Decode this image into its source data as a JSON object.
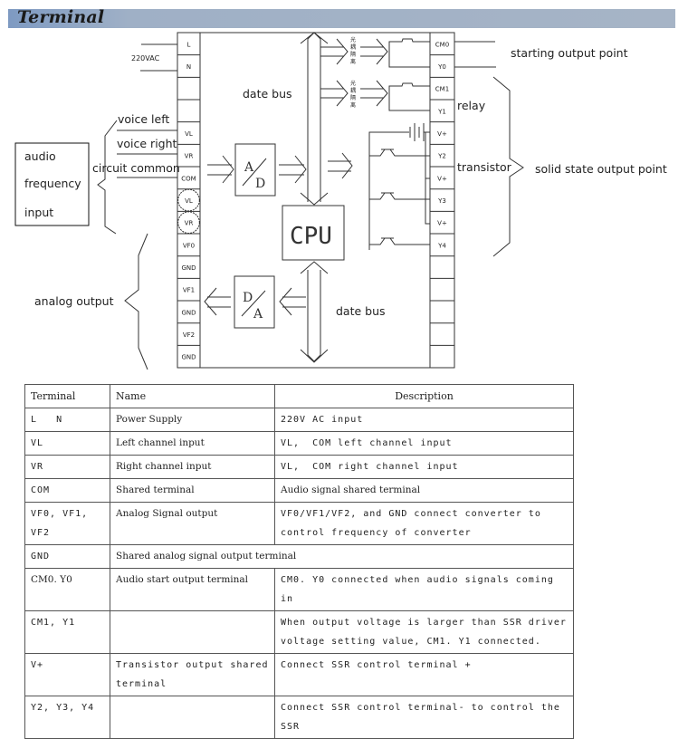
{
  "header": {
    "title": "Terminal",
    "bar_color": "#a6b4c6"
  },
  "diagram": {
    "power_label": "220VAC",
    "left_terminals": [
      "L",
      "N",
      "",
      "",
      "VL",
      "VR",
      "COM",
      "VL",
      "VR",
      "VF0",
      "GND",
      "VF1",
      "GND",
      "VF2",
      "GND"
    ],
    "right_terminals": [
      "CM0",
      "Y0",
      "CM1",
      "Y1",
      "V+",
      "Y2",
      "V+",
      "Y3",
      "V+",
      "Y4",
      "",
      "",
      "",
      "",
      ""
    ],
    "input_box": {
      "lines": [
        "audio",
        "frequency",
        "input"
      ]
    },
    "input_labels": {
      "voice_left": "voice left",
      "voice_right": "voice right",
      "circuit_common": "circuit common"
    },
    "analog_output": "analog output",
    "data_bus_top": "date bus",
    "data_bus_bottom": "date bus",
    "ad_converter": {
      "top": "A",
      "bottom": "D"
    },
    "da_converter": {
      "top": "D",
      "bottom": "A"
    },
    "cpu": "CPU",
    "optocoupler_chars": [
      "光",
      "耦",
      "隔",
      "离"
    ],
    "starting_output": "starting output point",
    "relay": "relay",
    "transistor": "transistor",
    "solid_state_output": "solid state output point"
  },
  "table": {
    "headers": [
      "Terminal",
      "Name",
      "Description"
    ],
    "rows": [
      {
        "terminal": "L   N",
        "name": "Power Supply",
        "description": "220V AC input"
      },
      {
        "terminal": "VL",
        "name": "Left channel input",
        "description": "VL,  COM left channel input"
      },
      {
        "terminal": "VR",
        "name": "Right channel input",
        "description": "VL,  COM right channel input"
      },
      {
        "terminal": "COM",
        "name": "Shared terminal",
        "description": "Audio signal shared terminal"
      },
      {
        "terminal": "VF0, VF1, VF2",
        "name": "Analog Signal output",
        "description": "VF0/VF1/VF2, and GND connect converter to control frequency of converter"
      },
      {
        "terminal": "GND",
        "name": "Shared analog signal output terminal",
        "description": ""
      },
      {
        "terminal": "CM0. Y0",
        "name": "Audio start output terminal",
        "description": "CM0. Y0  connected  when  audio  signals coming in"
      },
      {
        "terminal": "CM1, Y1",
        "name": "",
        "description": "When output voltage is larger than SSR driver voltage setting value, CM1. Y1 connected."
      },
      {
        "terminal": "V+",
        "name": "Transistor output shared terminal",
        "description": "Connect SSR control terminal +"
      },
      {
        "terminal": "Y2, Y3, Y4",
        "name": "",
        "description": "Connect SSR control terminal- to control the SSR"
      }
    ]
  }
}
